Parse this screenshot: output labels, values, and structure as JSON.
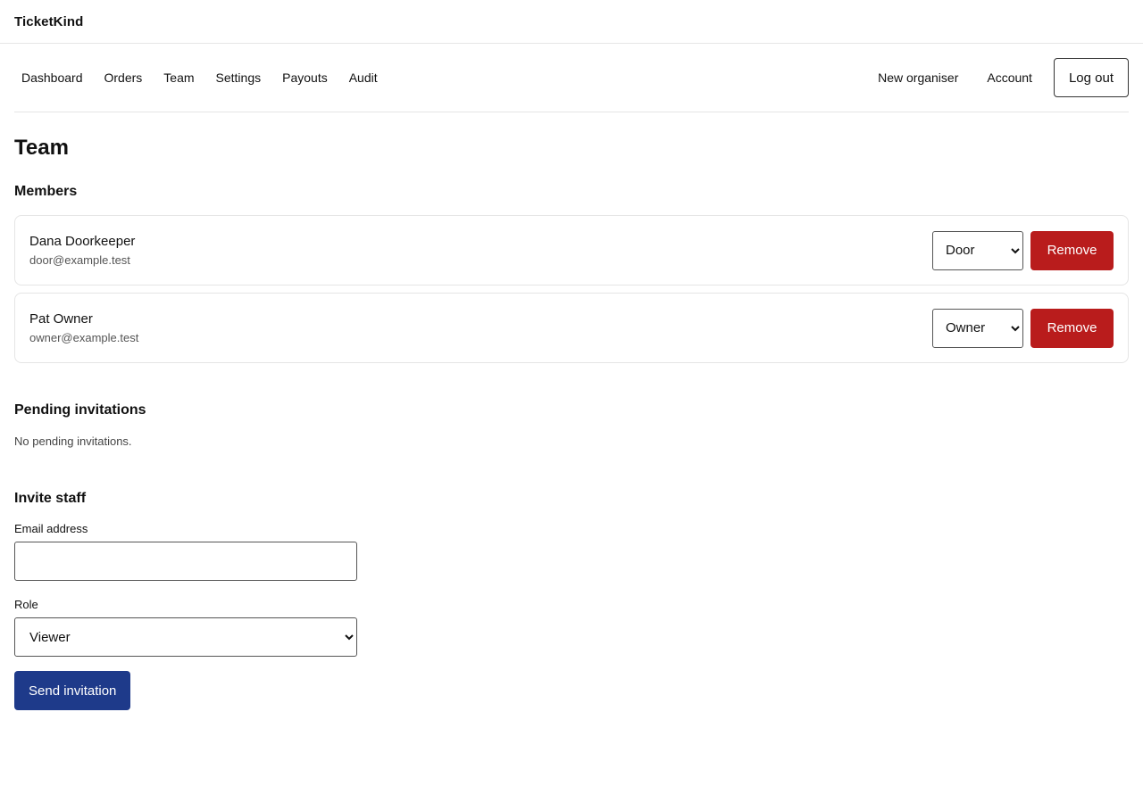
{
  "app": {
    "brand": "TicketKind"
  },
  "nav": {
    "left": [
      "Dashboard",
      "Orders",
      "Team",
      "Settings",
      "Payouts",
      "Audit"
    ],
    "right": [
      "New organiser",
      "Account"
    ],
    "logout_label": "Log out"
  },
  "page": {
    "title": "Team"
  },
  "members": {
    "heading": "Members",
    "remove_label": "Remove",
    "list": [
      {
        "name": "Dana Doorkeeper",
        "email": "door@example.test",
        "role": "Door"
      },
      {
        "name": "Pat Owner",
        "email": "owner@example.test",
        "role": "Owner"
      }
    ]
  },
  "pending": {
    "heading": "Pending invitations",
    "empty_text": "No pending invitations."
  },
  "invite": {
    "heading": "Invite staff",
    "email_label": "Email address",
    "email_value": "",
    "role_label": "Role",
    "role_value": "Viewer",
    "submit_label": "Send invitation"
  },
  "colors": {
    "danger": "#b91c1c",
    "primary": "#1e3a8a"
  }
}
